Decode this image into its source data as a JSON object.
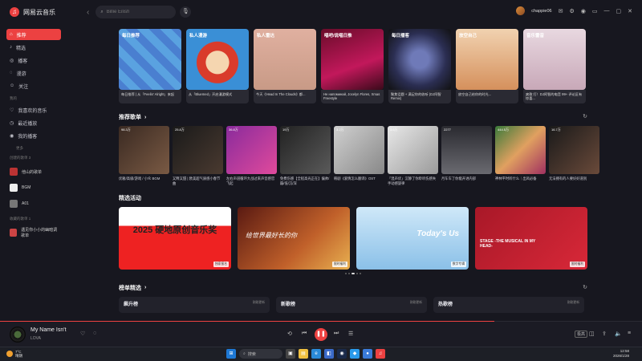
{
  "app": {
    "title": "网易云音乐"
  },
  "search": {
    "placeholder": "Billie Eilish"
  },
  "user": {
    "name": "chappie06"
  },
  "sidebar": {
    "items": [
      {
        "label": "推荐",
        "icon": "recommend-icon",
        "active": true
      },
      {
        "label": "精选",
        "icon": "selected-icon"
      },
      {
        "label": "播客",
        "icon": "podcast-icon"
      },
      {
        "label": "漫游",
        "icon": "roam-icon"
      },
      {
        "label": "关注",
        "icon": "follow-icon"
      }
    ],
    "my_section": "我的",
    "my_items": [
      {
        "label": "我喜欢的音乐",
        "icon": "heart-icon"
      },
      {
        "label": "最近播放",
        "icon": "recent-icon"
      },
      {
        "label": "我的播客",
        "icon": "my-podcast-icon"
      }
    ],
    "more": "更多",
    "created_section": "创建的歌单 3",
    "created_items": [
      {
        "label": "他山的歌单"
      },
      {
        "label": "BGM"
      },
      {
        "label": "A01"
      }
    ],
    "collected_section": "收藏的歌单 1",
    "collected_items": [
      {
        "label": "遇见你小小的幽暗调歌单"
      }
    ]
  },
  "top_cards": [
    {
      "tag": "每日推荐",
      "caption": "每日推荐 | 从「Feelin' Alright」来起"
    },
    {
      "tag": "私人漫游",
      "caption": "从「Bluemed」开启漫游模式"
    },
    {
      "tag": "私人雷达",
      "caption": "今天《Head In The Clouds》都..."
    },
    {
      "tag": "唱吧/说唱日推",
      "caption": "Не напоминай, Jocelyn Flores, Xmas Freestyle"
    },
    {
      "tag": "每日播客",
      "caption": "聚焦话题 + 满足你的收听 (DJ阿智 Remix)"
    },
    {
      "tag": "放空自己",
      "caption": "放空自己给你的时光..."
    },
    {
      "tag": "音乐雷音",
      "caption": "爽歌 打！DJ阿智的电音 99+ 评论区有惊喜..."
    }
  ],
  "sections": {
    "playlists": "推荐歌单",
    "activities": "精选活动",
    "rankings": "榜单精选"
  },
  "playlists": [
    {
      "count": "98.3万",
      "title": "优雅/高级/游戏 / 小众 BGM"
    },
    {
      "count": "25.8万",
      "title": "又释又甜 | 欧美超气质感小春节曲"
    },
    {
      "count": "36.8万",
      "title": "左右声道循环大战过来声音感官飞起"
    },
    {
      "count": "19万",
      "title": "免费伤感【全程高光正在】偏帅/蹦/低/沉/深"
    },
    {
      "count": "3.2万",
      "title": "韩剧《爱情怎么翻译》OST"
    },
    {
      "count": "3.6万",
      "title": "「混声优」沉静了你聆听伤感失手动感旋律"
    },
    {
      "count": "2277",
      "title": "月车车了你能开进内部"
    },
    {
      "count": "444.5万",
      "title": "神林平时听什么｜出风必备"
    },
    {
      "count": "16.7万",
      "title": "无法拥有的人要好好道别"
    }
  ],
  "activities": [
    {
      "title": "2025 硬地原创音乐奖",
      "badge": "独家报名"
    },
    {
      "title": "给世界最好长的你",
      "badge": "限时福利"
    },
    {
      "title": "Today's Us",
      "badge": "数字专辑"
    },
    {
      "title": "STAGE -THE MUSICAL IN MY HEAD-",
      "badge": "限时福利"
    }
  ],
  "rankings": [
    {
      "title": "飙升榜",
      "sub": "刚刚更新"
    },
    {
      "title": "新歌榜",
      "sub": "刚刚更新"
    },
    {
      "title": "热歌榜",
      "sub": "刚刚更新"
    }
  ],
  "player": {
    "song": "My Name Isn't",
    "artist": "LOVA",
    "progress": 0.77,
    "quality": "极高"
  },
  "taskbar": {
    "temp": "7°C",
    "weather": "晴朗",
    "search": "搜索",
    "time": "12:58",
    "date": "2026/1/28"
  },
  "colors": {
    "accent": "#ec4141",
    "bg": "#17171f"
  }
}
